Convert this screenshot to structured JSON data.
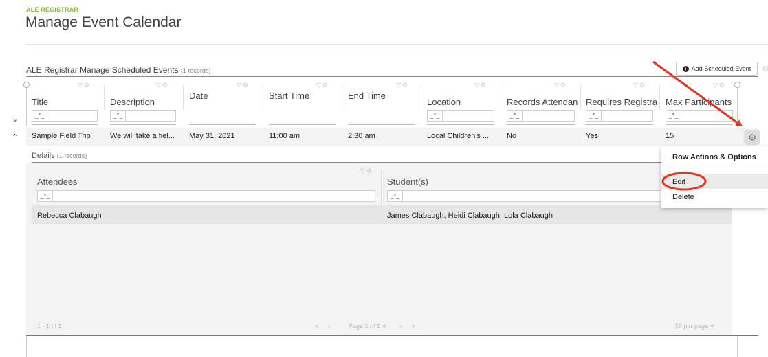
{
  "app": {
    "label": "ALE REGISTRAR",
    "title": "Manage Event Calendar"
  },
  "grid": {
    "title": "ALE Registrar Manage Scheduled Events",
    "count": "(1 records)",
    "add_button": "Add Scheduled Event",
    "filter_operator": "_*_",
    "columns": [
      "Title",
      "Description",
      "Date",
      "Start Time",
      "End Time",
      "Location",
      "Records Attendance",
      "Requires Registration",
      "Max Participants"
    ],
    "row": {
      "title": "Sample Field Trip",
      "description": "We will take a fiel...",
      "date": "May 31, 2021",
      "start_time": "11:00 am",
      "end_time": "2:30 am",
      "location": "Local Children's ...",
      "records_attendance": "No",
      "requires_registration": "Yes",
      "max_participants": "15"
    }
  },
  "details": {
    "title": "Details",
    "count": "(1 records)",
    "columns": [
      "Attendees",
      "Student(s)"
    ],
    "row": {
      "attendees": "Rebecca Clabaugh",
      "students": "James Clabaugh, Heidi Clabaugh, Lola Clabaugh"
    },
    "pager": {
      "range": "1 - 1 of 1",
      "page": "Page 1 of 1",
      "per_page": "50 per page"
    }
  },
  "menu": {
    "title": "Row Actions & Options",
    "items": [
      "Edit",
      "Delete"
    ]
  },
  "annotation_color": "#e8321e"
}
